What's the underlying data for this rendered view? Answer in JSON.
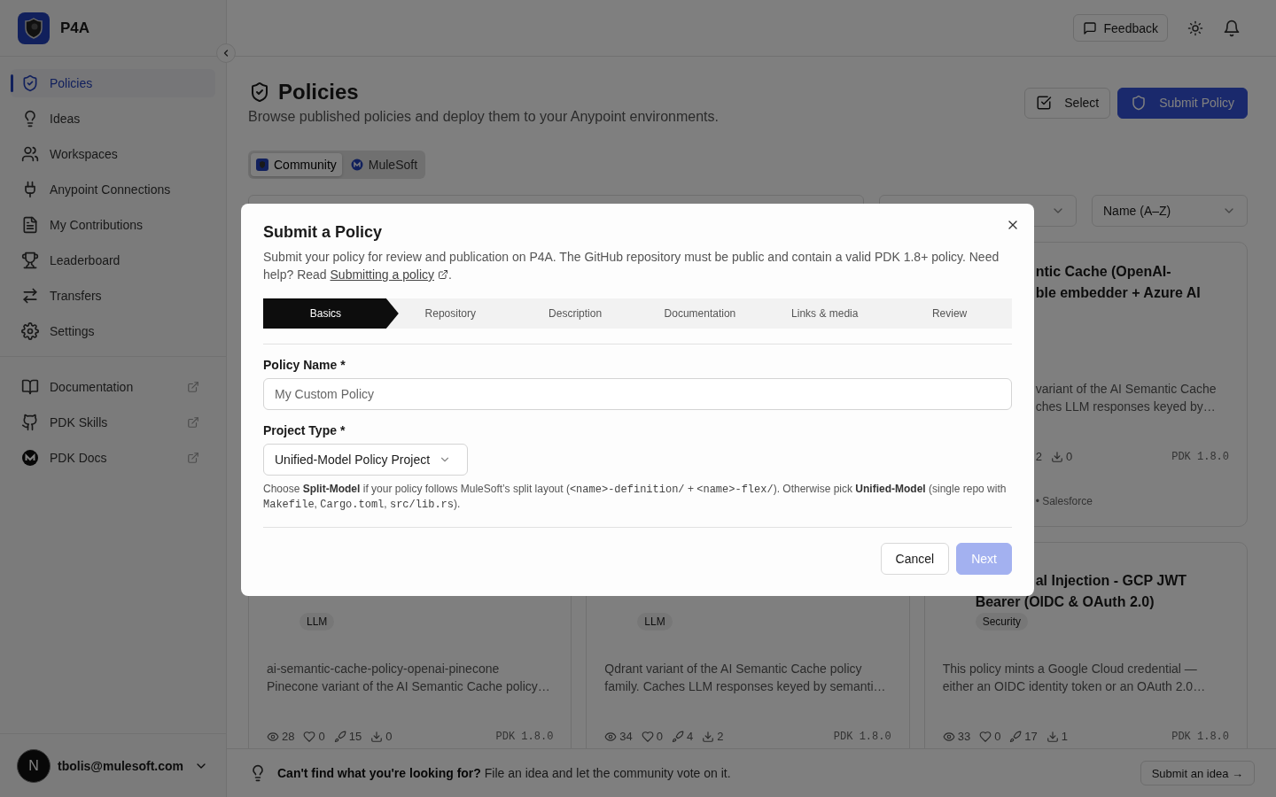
{
  "sidebar": {
    "brand": "P4A",
    "items": [
      {
        "label": "Policies",
        "selected": true
      },
      {
        "label": "Ideas",
        "selected": false
      },
      {
        "label": "Workspaces",
        "selected": false
      },
      {
        "label": "Anypoint Connections",
        "selected": false
      },
      {
        "label": "My Contributions",
        "selected": false
      },
      {
        "label": "Leaderboard",
        "selected": false
      },
      {
        "label": "Transfers",
        "selected": false
      },
      {
        "label": "Settings",
        "selected": false
      }
    ],
    "links": [
      {
        "label": "Documentation"
      },
      {
        "label": "PDK Skills"
      },
      {
        "label": "PDK Docs"
      }
    ],
    "user": {
      "avatar": "N",
      "email": "tbolis@mulesoft.com"
    }
  },
  "header": {
    "feedback": "Feedback"
  },
  "page": {
    "title": "Policies",
    "subtitle": "Browse published policies and deploy them to your Anypoint environments.",
    "select_button": "Select",
    "submit_button": "Submit Policy"
  },
  "source_tabs": [
    {
      "label": "Community",
      "selected": true
    },
    {
      "label": "MuleSoft",
      "selected": false
    }
  ],
  "sort": {
    "value": "Name (A–Z)"
  },
  "cards": [
    {
      "kind": "partial",
      "title_lines": [
        {
          "text": "ntic Cache (OpenAI-",
          "cut": true
        },
        {
          "text": "ble embedder + Azure AI",
          "cut": true
        }
      ],
      "description_lines": [
        "variant of the AI Semantic Cache",
        "ches LLM responses keyed by…"
      ],
      "stats": [
        {
          "kind": "cut",
          "value": "2"
        },
        {
          "kind": "downloads",
          "value": "0"
        }
      ],
      "version": "PDK 1.8.0",
      "footer": "• Salesforce"
    },
    {
      "kind": "full",
      "tag": "LLM",
      "description_lines": [
        "ai-semantic-cache-policy-openai-pinecone",
        "Pinecone variant of the AI Semantic Cache policy…"
      ],
      "stats": [
        {
          "kind": "views",
          "value": "28"
        },
        {
          "kind": "likes",
          "value": "0"
        },
        {
          "kind": "deploys",
          "value": "15"
        },
        {
          "kind": "downloads",
          "value": "0"
        }
      ],
      "version": "PDK 1.8.0"
    },
    {
      "kind": "full",
      "tag": "LLM",
      "description_lines": [
        "Qdrant variant of the AI Semantic Cache policy",
        "family. Caches LLM responses keyed by semanti…"
      ],
      "stats": [
        {
          "kind": "views",
          "value": "34"
        },
        {
          "kind": "likes",
          "value": "0"
        },
        {
          "kind": "deploys",
          "value": "4"
        },
        {
          "kind": "downloads",
          "value": "2"
        }
      ],
      "version": "PDK 1.8.0"
    },
    {
      "kind": "full",
      "title_lines": [
        {
          "text": "al Injection - GCP JWT",
          "cut": true
        },
        {
          "text": "Bearer (OIDC & OAuth 2.0)",
          "cut": false
        }
      ],
      "tag": "Security",
      "description_lines": [
        "This policy mints a Google Cloud credential —",
        "either an OIDC identity token or an OAuth 2.0…"
      ],
      "stats": [
        {
          "kind": "views",
          "value": "33"
        },
        {
          "kind": "likes",
          "value": "0"
        },
        {
          "kind": "deploys",
          "value": "17"
        },
        {
          "kind": "downloads",
          "value": "1"
        }
      ],
      "version": "PDK 1.8.0"
    }
  ],
  "banner": {
    "text": "**Can't find what you're looking for?** File an idea and let the community vote on it.",
    "button": "Submit an idea →"
  },
  "modal": {
    "title": "Submit a Policy",
    "description": "Submit your policy for review and publication on P4A. The GitHub repository must be public and contain a valid PDK 1.8+ policy. Need help? Read ",
    "link": "Submitting a policy",
    "description_end": ".",
    "steps": [
      {
        "label": "Basics",
        "selected": true
      },
      {
        "label": "Repository",
        "selected": false
      },
      {
        "label": "Description",
        "selected": false
      },
      {
        "label": "Documentation",
        "selected": false
      },
      {
        "label": "Links & media",
        "selected": false
      },
      {
        "label": "Review",
        "selected": false
      }
    ],
    "name_label": "Policy Name *",
    "name_placeholder": "My Custom Policy",
    "type_label": "Project Type *",
    "type_value": "Unified-Model Policy Project",
    "hint": [
      {
        "kind": "text",
        "text": "Choose **Split-Model** if your policy follows MuleSoft’s split layout ("
      },
      {
        "kind": "code",
        "text": "<name>-definition/"
      },
      {
        "kind": "text",
        "text": " + "
      },
      {
        "kind": "code",
        "text": "<name>-flex/"
      },
      {
        "kind": "text",
        "text": "). Otherwise pick **Unified-Model** (single repo with "
      },
      {
        "kind": "code",
        "text": "Makefile"
      },
      {
        "kind": "text",
        "text": ", "
      },
      {
        "kind": "code",
        "text": "Cargo.toml"
      },
      {
        "kind": "text",
        "text": ", "
      },
      {
        "kind": "code",
        "text": "src/lib.rs"
      },
      {
        "kind": "text",
        "text": ")."
      }
    ],
    "cancel": "Cancel",
    "next": "Next",
    "next_disabled": true
  }
}
